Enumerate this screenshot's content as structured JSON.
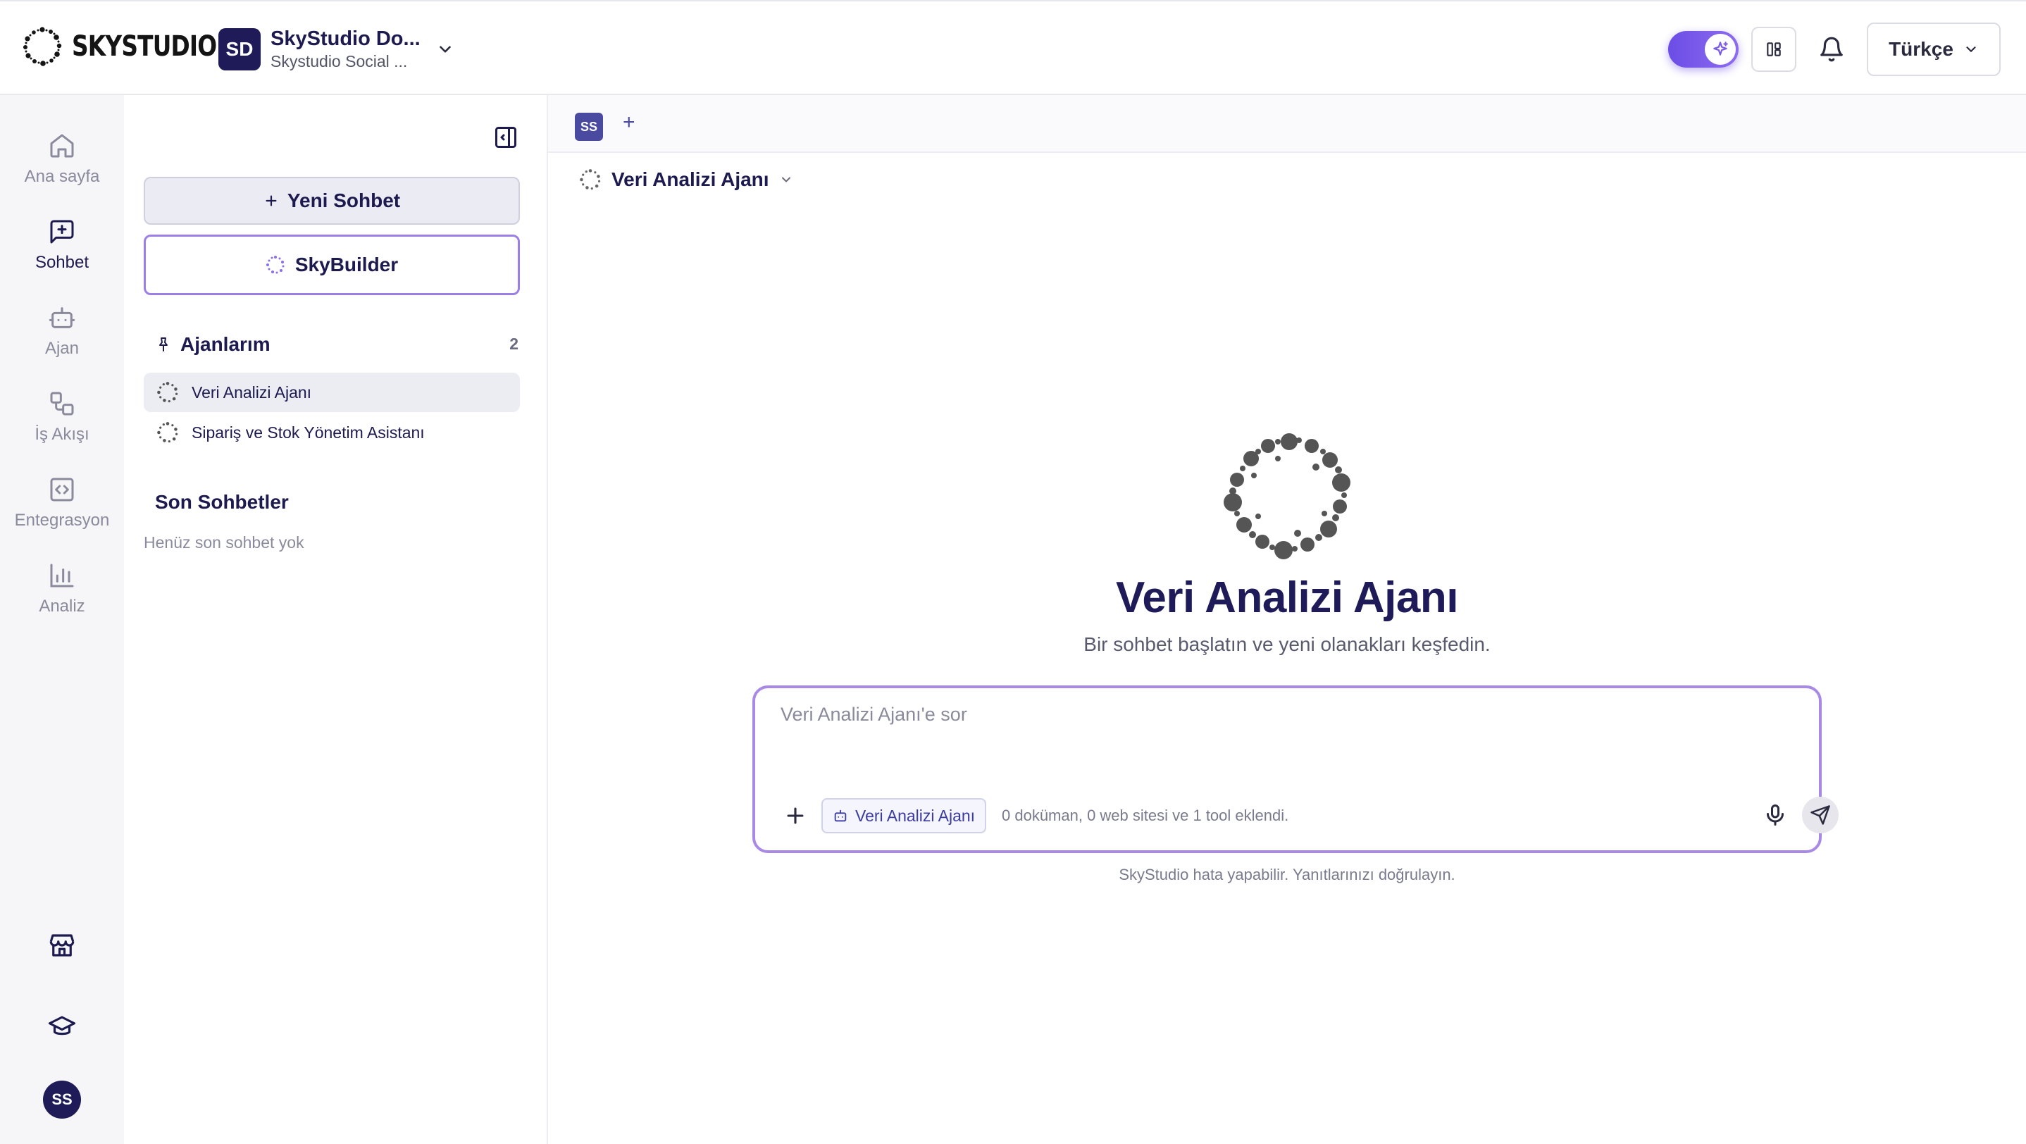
{
  "header": {
    "logo_text": "SKYSTUDIO",
    "workspace": {
      "avatar": "SD",
      "name": "SkyStudio Do...",
      "subtitle": "Skystudio Social ..."
    },
    "language": "Türkçe"
  },
  "rail": {
    "items": [
      {
        "label": "Ana sayfa",
        "icon": "home-icon"
      },
      {
        "label": "Sohbet",
        "icon": "chat-plus-icon",
        "active": true
      },
      {
        "label": "Ajan",
        "icon": "bot-icon"
      },
      {
        "label": "İş Akışı",
        "icon": "workflow-icon"
      },
      {
        "label": "Entegrasyon",
        "icon": "code-icon"
      },
      {
        "label": "Analiz",
        "icon": "chart-icon"
      }
    ],
    "user_avatar": "SS"
  },
  "sidebar": {
    "new_chat_label": "Yeni Sohbet",
    "skybuilder_label": "SkyBuilder",
    "agents_title": "Ajanlarım",
    "agents_count": "2",
    "agents": [
      {
        "name": "Veri Analizi Ajanı",
        "active": true
      },
      {
        "name": "Sipariş ve Stok Yönetim Asistanı",
        "active": false
      }
    ],
    "recent_title": "Son Sohbetler",
    "recent_empty": "Henüz son sohbet yok"
  },
  "main": {
    "tab_label": "SS",
    "tab_add": "+",
    "agent_selector": "Veri Analizi Ajanı",
    "hero_title": "Veri Analizi Ajanı",
    "hero_subtitle": "Bir sohbet başlatın ve yeni olanakları keşfedin.",
    "composer": {
      "placeholder": "Veri Analizi Ajanı'e sor",
      "chip_label": "Veri Analizi Ajanı",
      "attach_note": "0 doküman, 0 web sitesi ve 1 tool eklendi."
    },
    "disclaimer": "SkyStudio hata yapabilir. Yanıtlarınızı doğrulayın."
  },
  "colors": {
    "brand_dark": "#1e1b58",
    "accent_purple": "#8d6cf0",
    "composer_border": "#a88ae6"
  }
}
